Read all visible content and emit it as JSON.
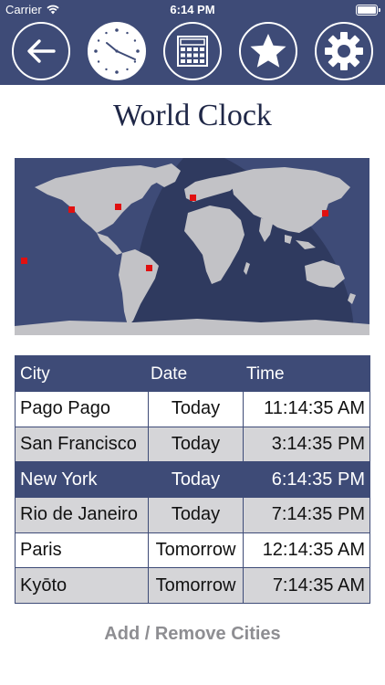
{
  "status_bar": {
    "carrier": "Carrier",
    "time": "6:14 PM",
    "battery_level": 1.0
  },
  "toolbar": {
    "buttons": [
      {
        "name": "back",
        "icon": "arrow-left-icon"
      },
      {
        "name": "clock",
        "icon": "clock-icon",
        "active": true
      },
      {
        "name": "calculator",
        "icon": "calculator-icon"
      },
      {
        "name": "favorites",
        "icon": "star-icon"
      },
      {
        "name": "settings",
        "icon": "gear-icon"
      }
    ]
  },
  "title": "World Clock",
  "map": {
    "icon": "world-map-icon",
    "colors": {
      "ocean_day": "#3e4b77",
      "ocean_night": "#2f3a5f",
      "land": "#c2c2c6",
      "marker": "#e01010"
    }
  },
  "table": {
    "headers": {
      "city": "City",
      "date": "Date",
      "time": "Time"
    },
    "rows": [
      {
        "city": "Pago Pago",
        "date": "Today",
        "time": "11:14:35 AM"
      },
      {
        "city": "San Francisco",
        "date": "Today",
        "time": "3:14:35 PM"
      },
      {
        "city": "New York",
        "date": "Today",
        "time": "6:14:35 PM",
        "selected": true
      },
      {
        "city": "Rio de Janeiro",
        "date": "Today",
        "time": "7:14:35 PM"
      },
      {
        "city": "Paris",
        "date": "Tomorrow",
        "time": "12:14:35 AM"
      },
      {
        "city": "Kyōto",
        "date": "Tomorrow",
        "time": "7:14:35 AM"
      }
    ]
  },
  "add_remove_label": "Add / Remove Cities",
  "colors": {
    "accent": "#3e4b77",
    "title": "#1f2747",
    "alt_row": "#d5d5d8",
    "link_gray": "#8e8e92"
  }
}
